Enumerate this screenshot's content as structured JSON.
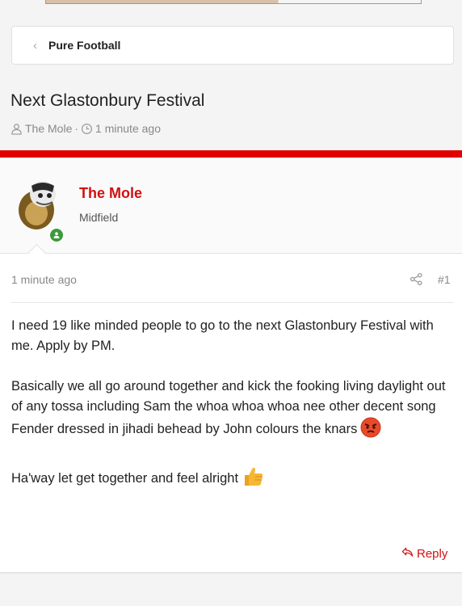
{
  "breadcrumb": {
    "label": "Pure Football"
  },
  "thread": {
    "title": "Next Glastonbury Festival",
    "author": "The Mole",
    "separator": "·",
    "time": "1 minute ago"
  },
  "post": {
    "author_name": "The Mole",
    "author_role": "Midfield",
    "time": "1 minute ago",
    "number": "#1",
    "paragraphs": [
      "I need 19 like minded people to go to the next Glastonbury Festival with me. Apply by PM.",
      "Basically we all go around together and kick the fooking living daylight out of any tossa including Sam the whoa whoa whoa nee other decent song Fender dressed in jihadi behead by John colours the knars",
      "Ha'way let get together and feel alright"
    ],
    "reply_label": "Reply"
  },
  "colors": {
    "accent": "#e00000",
    "author": "#d11010",
    "online": "#3c9a3c"
  },
  "icons": [
    "chevron-left-icon",
    "user-icon",
    "clock-icon",
    "share-icon",
    "reply-icon",
    "angry-face-emoji",
    "thumbs-up-emoji"
  ]
}
